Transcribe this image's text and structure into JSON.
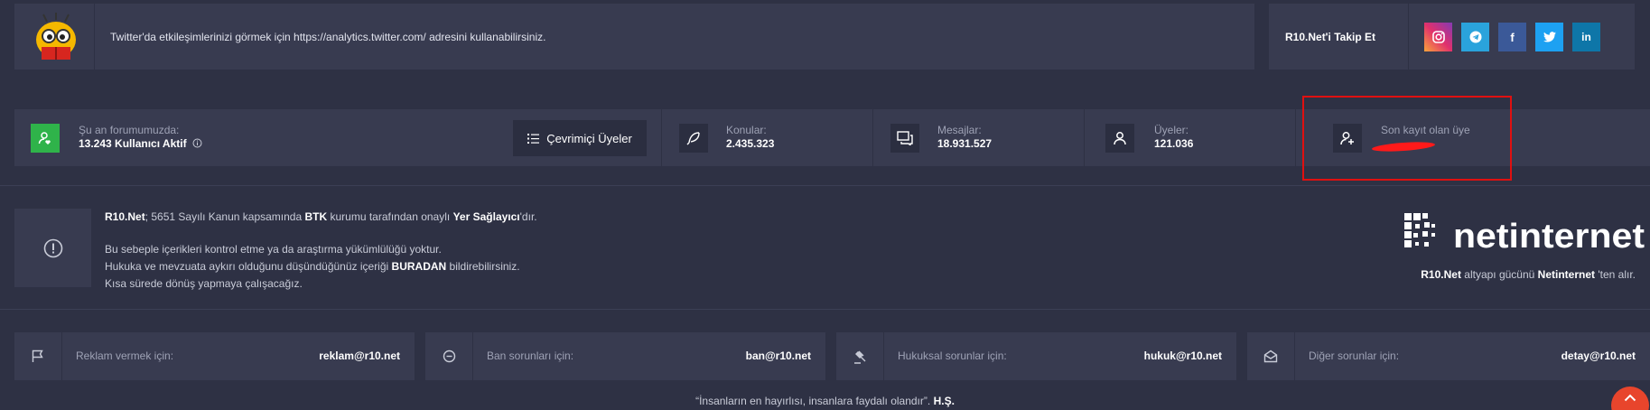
{
  "top_bar": {
    "message": "Twitter'da etkileşimlerinizi görmek için https://analytics.twitter.com/ adresini kullanabilirsiniz.",
    "follow_label": "R10.Net'i Takip Et",
    "social": [
      {
        "name": "instagram",
        "color": "#d6249f"
      },
      {
        "name": "telegram",
        "color": "#2aa3dc"
      },
      {
        "name": "facebook",
        "color": "#3b5998"
      },
      {
        "name": "twitter",
        "color": "#1da1f2"
      },
      {
        "name": "linkedin",
        "color": "#0e76a8"
      }
    ],
    "linkedin_label": "in",
    "facebook_label": "f"
  },
  "stats": {
    "online_label": "Şu an forumumuzda:",
    "online_value": "13.243 Kullanıcı Aktif",
    "online_button": "Çevrimiçi Üyeler",
    "topics_label": "Konular:",
    "topics_value": "2.435.323",
    "messages_label": "Mesajlar:",
    "messages_value": "18.931.527",
    "members_label": "Üyeler:",
    "members_value": "121.036",
    "last_member_label": "Son kayıt olan üye"
  },
  "notice": {
    "site": "R10.Net",
    "line1_a": "; 5651 Sayılı Kanun kapsamında ",
    "btk": "BTK",
    "line1_b": " kurumu tarafından onaylı ",
    "provider": "Yer Sağlayıcı",
    "line1_c": "'dır.",
    "line2": "Bu sebeple içerikleri kontrol etme ya da araştırma yükümlülüğü yoktur.",
    "line3_a": "Hukuka ve mevzuata aykırı olduğunu düşündüğünüz içeriği ",
    "here": "BURADAN",
    "line3_b": " bildirebilirsiniz.",
    "line4": "Kısa sürede dönüş yapmaya çalışacağız."
  },
  "infra": {
    "logo_text": "netinternet",
    "site": "R10.Net",
    "mid": " altyapı gücünü ",
    "provider": "Netinternet",
    "end": " 'ten alır."
  },
  "contacts": [
    {
      "label": "Reklam vermek için:",
      "email": "reklam@r10.net"
    },
    {
      "label": "Ban sorunları için:",
      "email": "ban@r10.net"
    },
    {
      "label": "Hukuksal sorunlar için:",
      "email": "hukuk@r10.net"
    },
    {
      "label": "Diğer sorunlar için:",
      "email": "detay@r10.net"
    }
  ],
  "footer": {
    "quote": "“İnsanların en hayırlısı, insanlara faydalı olandır”.",
    "author": "H.Ş."
  },
  "colors": {
    "accent_green": "#2fb34a",
    "highlight_red": "#e01010",
    "scroll_top": "#e8452c"
  }
}
